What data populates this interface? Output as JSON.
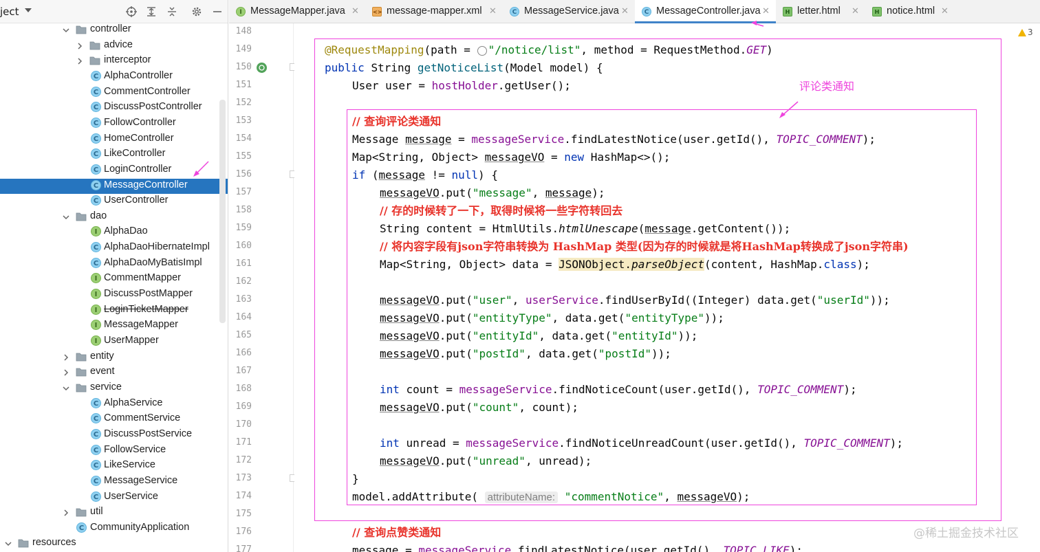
{
  "project_panel": {
    "title": "ject",
    "tree": [
      {
        "label": "controller",
        "kind": "folder",
        "expanded": true
      },
      {
        "label": "advice",
        "kind": "folder",
        "expanded": false
      },
      {
        "label": "interceptor",
        "kind": "folder",
        "expanded": false
      },
      {
        "label": "AlphaController",
        "kind": "class"
      },
      {
        "label": "CommentController",
        "kind": "class"
      },
      {
        "label": "DiscussPostController",
        "kind": "class"
      },
      {
        "label": "FollowController",
        "kind": "class"
      },
      {
        "label": "HomeController",
        "kind": "class"
      },
      {
        "label": "LikeController",
        "kind": "class"
      },
      {
        "label": "LoginController",
        "kind": "class"
      },
      {
        "label": "MessageController",
        "kind": "class",
        "selected": true
      },
      {
        "label": "UserController",
        "kind": "class"
      },
      {
        "label": "dao",
        "kind": "folder",
        "expanded": true
      },
      {
        "label": "AlphaDao",
        "kind": "interface"
      },
      {
        "label": "AlphaDaoHibernateImpl",
        "kind": "class"
      },
      {
        "label": "AlphaDaoMyBatisImpl",
        "kind": "class"
      },
      {
        "label": "CommentMapper",
        "kind": "interface"
      },
      {
        "label": "DiscussPostMapper",
        "kind": "interface"
      },
      {
        "label": "LoginTicketMapper",
        "kind": "interface",
        "strikethrough": true
      },
      {
        "label": "MessageMapper",
        "kind": "interface"
      },
      {
        "label": "UserMapper",
        "kind": "interface"
      },
      {
        "label": "entity",
        "kind": "folder",
        "expanded": false
      },
      {
        "label": "event",
        "kind": "folder",
        "expanded": false
      },
      {
        "label": "service",
        "kind": "folder",
        "expanded": true
      },
      {
        "label": "AlphaService",
        "kind": "class"
      },
      {
        "label": "CommentService",
        "kind": "class"
      },
      {
        "label": "DiscussPostService",
        "kind": "class"
      },
      {
        "label": "FollowService",
        "kind": "class"
      },
      {
        "label": "LikeService",
        "kind": "class"
      },
      {
        "label": "MessageService",
        "kind": "class"
      },
      {
        "label": "UserService",
        "kind": "class"
      },
      {
        "label": "util",
        "kind": "folder",
        "expanded": false
      },
      {
        "label": "CommunityApplication",
        "kind": "app"
      },
      {
        "label": "resources",
        "kind": "folder",
        "expanded": true
      }
    ]
  },
  "tabs": [
    {
      "label": "MessageMapper.java",
      "icon": "interface-icon",
      "active": false
    },
    {
      "label": "message-mapper.xml",
      "icon": "xml-file-icon",
      "active": false
    },
    {
      "label": "MessageService.java",
      "icon": "class-icon",
      "active": false
    },
    {
      "label": "MessageController.java",
      "icon": "class-icon",
      "active": true
    },
    {
      "label": "letter.html",
      "icon": "html-file-icon",
      "active": false
    },
    {
      "label": "notice.html",
      "icon": "html-file-icon",
      "active": false
    }
  ],
  "line_numbers": [
    "148",
    "149",
    "150",
    "151",
    "152",
    "153",
    "154",
    "155",
    "156",
    "157",
    "158",
    "159",
    "160",
    "161",
    "162",
    "163",
    "164",
    "165",
    "166",
    "167",
    "168",
    "169",
    "170",
    "171",
    "172",
    "173",
    "174",
    "175",
    "176",
    "177"
  ],
  "code_lines": [
    {
      "indent": 0,
      "tokens": []
    },
    {
      "indent": 1,
      "tokens": [
        {
          "t": "@RequestMapping",
          "c": "ann"
        },
        {
          "t": "(path = "
        },
        {
          "t": "globe",
          "c": "globe"
        },
        {
          "t": "\"/notice/list\"",
          "c": "str"
        },
        {
          "t": ", method = RequestMethod."
        },
        {
          "t": "GET",
          "c": "const"
        },
        {
          "t": ")"
        }
      ]
    },
    {
      "indent": 1,
      "tokens": [
        {
          "t": "public ",
          "c": "kw"
        },
        {
          "t": "String "
        },
        {
          "t": "getNoticeList",
          "c": "method"
        },
        {
          "t": "(Model model) {"
        }
      ]
    },
    {
      "indent": 2,
      "tokens": [
        {
          "t": "User user = "
        },
        {
          "t": "hostHolder",
          "c": "field"
        },
        {
          "t": ".getUser();"
        }
      ]
    },
    {
      "indent": 0,
      "tokens": []
    },
    {
      "indent": 2,
      "tokens": [
        {
          "t": "// 查询评论类通知",
          "c": "comment"
        }
      ]
    },
    {
      "indent": 2,
      "tokens": [
        {
          "t": "Message "
        },
        {
          "t": "message",
          "c": "uline"
        },
        {
          "t": " = "
        },
        {
          "t": "messageService",
          "c": "field"
        },
        {
          "t": ".findLatestNotice(user.getId(), "
        },
        {
          "t": "TOPIC_COMMENT",
          "c": "const"
        },
        {
          "t": ");"
        }
      ]
    },
    {
      "indent": 2,
      "tokens": [
        {
          "t": "Map<String, Object> "
        },
        {
          "t": "messageVO",
          "c": "uline"
        },
        {
          "t": " = "
        },
        {
          "t": "new ",
          "c": "kw"
        },
        {
          "t": "HashMap<>();"
        }
      ]
    },
    {
      "indent": 2,
      "tokens": [
        {
          "t": "if ",
          "c": "kw"
        },
        {
          "t": "("
        },
        {
          "t": "message",
          "c": "uline"
        },
        {
          "t": " != "
        },
        {
          "t": "null",
          "c": "kw"
        },
        {
          "t": ") {"
        }
      ]
    },
    {
      "indent": 3,
      "tokens": [
        {
          "t": "messageVO",
          "c": "uline"
        },
        {
          "t": ".put("
        },
        {
          "t": "\"message\"",
          "c": "str"
        },
        {
          "t": ", "
        },
        {
          "t": "message",
          "c": "uline"
        },
        {
          "t": ");"
        }
      ]
    },
    {
      "indent": 3,
      "tokens": [
        {
          "t": "// 存的时候转了一下，取得时候将一些字符转回去",
          "c": "comment"
        }
      ]
    },
    {
      "indent": 3,
      "tokens": [
        {
          "t": "String content = HtmlUtils."
        },
        {
          "t": "htmlUnescape",
          "c": "italic"
        },
        {
          "t": "("
        },
        {
          "t": "message",
          "c": "uline"
        },
        {
          "t": ".getContent());"
        }
      ]
    },
    {
      "indent": 3,
      "tokens": [
        {
          "t": "// 将内容字段有json字符串转换为 HashMap 类型(因为存的时候就是将HashMap转换成了json字符串)",
          "c": "comment"
        }
      ]
    },
    {
      "indent": 3,
      "tokens": [
        {
          "t": "Map<String, Object> data = "
        },
        {
          "t": "JSONObject.",
          "c": "hl"
        },
        {
          "t": "parseObject",
          "c": "hl italic"
        },
        {
          "t": "(content, HashMap."
        },
        {
          "t": "class",
          "c": "kw"
        },
        {
          "t": ");"
        }
      ]
    },
    {
      "indent": 0,
      "tokens": []
    },
    {
      "indent": 3,
      "tokens": [
        {
          "t": "messageVO",
          "c": "uline"
        },
        {
          "t": ".put("
        },
        {
          "t": "\"user\"",
          "c": "str"
        },
        {
          "t": ", "
        },
        {
          "t": "userService",
          "c": "field"
        },
        {
          "t": ".findUserById((Integer) data.get("
        },
        {
          "t": "\"userId\"",
          "c": "str"
        },
        {
          "t": "));"
        }
      ]
    },
    {
      "indent": 3,
      "tokens": [
        {
          "t": "messageVO",
          "c": "uline"
        },
        {
          "t": ".put("
        },
        {
          "t": "\"entityType\"",
          "c": "str"
        },
        {
          "t": ", data.get("
        },
        {
          "t": "\"entityType\"",
          "c": "str"
        },
        {
          "t": "));"
        }
      ]
    },
    {
      "indent": 3,
      "tokens": [
        {
          "t": "messageVO",
          "c": "uline"
        },
        {
          "t": ".put("
        },
        {
          "t": "\"entityId\"",
          "c": "str"
        },
        {
          "t": ", data.get("
        },
        {
          "t": "\"entityId\"",
          "c": "str"
        },
        {
          "t": "));"
        }
      ]
    },
    {
      "indent": 3,
      "tokens": [
        {
          "t": "messageVO",
          "c": "uline"
        },
        {
          "t": ".put("
        },
        {
          "t": "\"postId\"",
          "c": "str"
        },
        {
          "t": ", data.get("
        },
        {
          "t": "\"postId\"",
          "c": "str"
        },
        {
          "t": "));"
        }
      ]
    },
    {
      "indent": 0,
      "tokens": []
    },
    {
      "indent": 3,
      "tokens": [
        {
          "t": "int ",
          "c": "kw"
        },
        {
          "t": "count = "
        },
        {
          "t": "messageService",
          "c": "field"
        },
        {
          "t": ".findNoticeCount(user.getId(), "
        },
        {
          "t": "TOPIC_COMMENT",
          "c": "const"
        },
        {
          "t": ");"
        }
      ]
    },
    {
      "indent": 3,
      "tokens": [
        {
          "t": "messageVO",
          "c": "uline"
        },
        {
          "t": ".put("
        },
        {
          "t": "\"count\"",
          "c": "str"
        },
        {
          "t": ", count);"
        }
      ]
    },
    {
      "indent": 0,
      "tokens": []
    },
    {
      "indent": 3,
      "tokens": [
        {
          "t": "int ",
          "c": "kw"
        },
        {
          "t": "unread = "
        },
        {
          "t": "messageService",
          "c": "field"
        },
        {
          "t": ".findNoticeUnreadCount(user.getId(), "
        },
        {
          "t": "TOPIC_COMMENT",
          "c": "const"
        },
        {
          "t": ");"
        }
      ]
    },
    {
      "indent": 3,
      "tokens": [
        {
          "t": "messageVO",
          "c": "uline"
        },
        {
          "t": ".put("
        },
        {
          "t": "\"unread\"",
          "c": "str"
        },
        {
          "t": ", unread);"
        }
      ]
    },
    {
      "indent": 2,
      "tokens": [
        {
          "t": "}"
        }
      ]
    },
    {
      "indent": 2,
      "tokens": [
        {
          "t": "model.addAttribute( "
        },
        {
          "t": "attributeName:",
          "c": "hint"
        },
        {
          "t": " "
        },
        {
          "t": "\"commentNotice\"",
          "c": "str"
        },
        {
          "t": ", "
        },
        {
          "t": "messageVO",
          "c": "uline"
        },
        {
          "t": ");"
        }
      ]
    },
    {
      "indent": 0,
      "tokens": []
    },
    {
      "indent": 2,
      "tokens": [
        {
          "t": "// 查询点赞类通知",
          "c": "comment"
        }
      ]
    },
    {
      "indent": 2,
      "tokens": [
        {
          "t": "message",
          "c": "uline"
        },
        {
          "t": " = "
        },
        {
          "t": "messageService",
          "c": "field"
        },
        {
          "t": ".findLatestNotice(user.getId(), "
        },
        {
          "t": "TOPIC_LIKE",
          "c": "const"
        },
        {
          "t": ");"
        }
      ]
    }
  ],
  "annotation": {
    "label": "评论类通知",
    "color": "#ee44dd"
  },
  "inspection": {
    "count": "3"
  },
  "watermark": "@稀土掘金技术社区"
}
